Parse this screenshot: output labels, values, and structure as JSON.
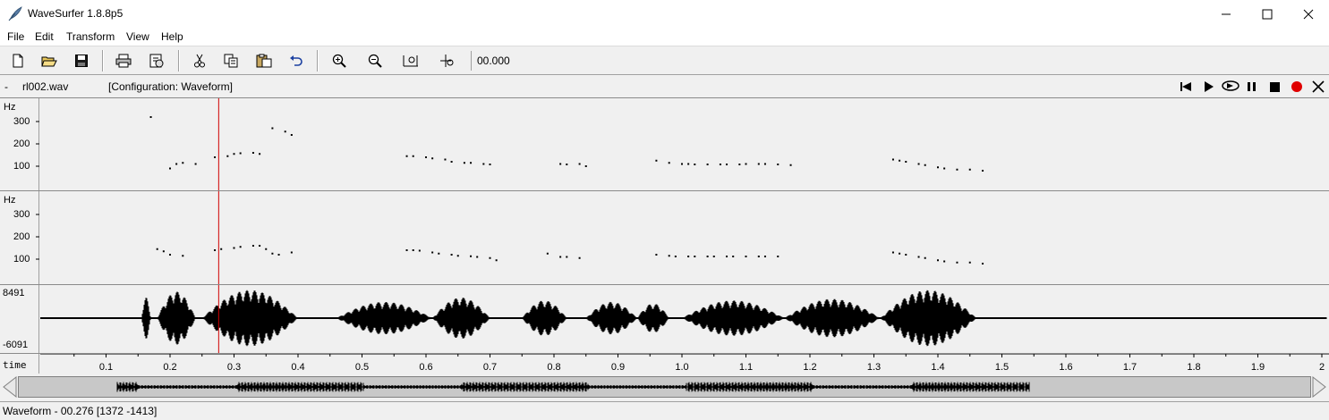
{
  "window": {
    "title": "WaveSurfer 1.8.8p5"
  },
  "menu": [
    "File",
    "Edit",
    "Transform",
    "View",
    "Help"
  ],
  "toolbar": {
    "time_value": "00.000"
  },
  "file": {
    "dash": "-",
    "name": "rl002.wav",
    "configuration": "[Configuration: Waveform]"
  },
  "pitch_pane_1": {
    "unit": "Hz",
    "ticks": [
      "300",
      "200",
      "100"
    ]
  },
  "pitch_pane_2": {
    "unit": "Hz",
    "ticks": [
      "300",
      "200",
      "100"
    ]
  },
  "waveform_pane": {
    "max": "8491",
    "min": "-6091"
  },
  "time_axis": {
    "label": "time",
    "ticks": [
      "0.1",
      "0.2",
      "0.3",
      "0.4",
      "0.5",
      "0.6",
      "0.7",
      "0.8",
      "0.9",
      "1.0",
      "1.1",
      "1.2",
      "1.3",
      "1.4",
      "1.5",
      "1.6",
      "1.7",
      "1.8",
      "1.9",
      "2"
    ]
  },
  "status": {
    "text": "Waveform - 00.276 [1372 -1413]"
  },
  "cursor_time": 0.276,
  "chart_data": [
    {
      "type": "scatter",
      "ylabel": "Hz",
      "ylim": [
        0,
        400
      ],
      "series": [
        {
          "points": [
            [
              0.17,
              320
            ],
            [
              0.2,
              90
            ],
            [
              0.21,
              110
            ],
            [
              0.22,
              115
            ],
            [
              0.24,
              110
            ],
            [
              0.27,
              140
            ],
            [
              0.29,
              145
            ],
            [
              0.3,
              155
            ],
            [
              0.31,
              158
            ],
            [
              0.33,
              160
            ],
            [
              0.34,
              155
            ],
            [
              0.36,
              270
            ],
            [
              0.38,
              255
            ],
            [
              0.39,
              240
            ],
            [
              0.57,
              145
            ],
            [
              0.58,
              145
            ],
            [
              0.6,
              140
            ],
            [
              0.61,
              135
            ],
            [
              0.63,
              130
            ],
            [
              0.64,
              120
            ],
            [
              0.66,
              115
            ],
            [
              0.67,
              115
            ],
            [
              0.69,
              110
            ],
            [
              0.7,
              108
            ],
            [
              0.81,
              110
            ],
            [
              0.82,
              108
            ],
            [
              0.84,
              110
            ],
            [
              0.85,
              100
            ],
            [
              0.96,
              125
            ],
            [
              0.98,
              115
            ],
            [
              1.0,
              110
            ],
            [
              1.01,
              110
            ],
            [
              1.02,
              108
            ],
            [
              1.04,
              108
            ],
            [
              1.06,
              108
            ],
            [
              1.07,
              108
            ],
            [
              1.09,
              108
            ],
            [
              1.1,
              110
            ],
            [
              1.12,
              110
            ],
            [
              1.13,
              110
            ],
            [
              1.15,
              108
            ],
            [
              1.17,
              105
            ],
            [
              1.33,
              130
            ],
            [
              1.34,
              125
            ],
            [
              1.35,
              120
            ],
            [
              1.37,
              110
            ],
            [
              1.38,
              105
            ],
            [
              1.4,
              95
            ],
            [
              1.41,
              90
            ],
            [
              1.43,
              85
            ],
            [
              1.45,
              85
            ],
            [
              1.47,
              80
            ]
          ]
        }
      ]
    },
    {
      "type": "scatter",
      "ylabel": "Hz",
      "ylim": [
        0,
        400
      ],
      "series": [
        {
          "points": [
            [
              0.18,
              145
            ],
            [
              0.19,
              135
            ],
            [
              0.2,
              120
            ],
            [
              0.22,
              115
            ],
            [
              0.27,
              140
            ],
            [
              0.28,
              145
            ],
            [
              0.3,
              150
            ],
            [
              0.31,
              155
            ],
            [
              0.33,
              160
            ],
            [
              0.34,
              160
            ],
            [
              0.35,
              145
            ],
            [
              0.36,
              125
            ],
            [
              0.37,
              120
            ],
            [
              0.39,
              130
            ],
            [
              0.57,
              140
            ],
            [
              0.58,
              140
            ],
            [
              0.59,
              138
            ],
            [
              0.61,
              130
            ],
            [
              0.62,
              125
            ],
            [
              0.64,
              120
            ],
            [
              0.65,
              115
            ],
            [
              0.67,
              113
            ],
            [
              0.68,
              110
            ],
            [
              0.7,
              105
            ],
            [
              0.71,
              95
            ],
            [
              0.79,
              125
            ],
            [
              0.81,
              110
            ],
            [
              0.82,
              110
            ],
            [
              0.84,
              105
            ],
            [
              0.96,
              120
            ],
            [
              0.98,
              115
            ],
            [
              0.99,
              112
            ],
            [
              1.01,
              112
            ],
            [
              1.02,
              112
            ],
            [
              1.04,
              112
            ],
            [
              1.05,
              112
            ],
            [
              1.07,
              112
            ],
            [
              1.08,
              112
            ],
            [
              1.1,
              112
            ],
            [
              1.12,
              112
            ],
            [
              1.13,
              112
            ],
            [
              1.15,
              112
            ],
            [
              1.33,
              130
            ],
            [
              1.34,
              125
            ],
            [
              1.35,
              120
            ],
            [
              1.37,
              110
            ],
            [
              1.38,
              105
            ],
            [
              1.4,
              95
            ],
            [
              1.41,
              90
            ],
            [
              1.43,
              85
            ],
            [
              1.45,
              85
            ],
            [
              1.47,
              80
            ]
          ]
        }
      ]
    }
  ]
}
